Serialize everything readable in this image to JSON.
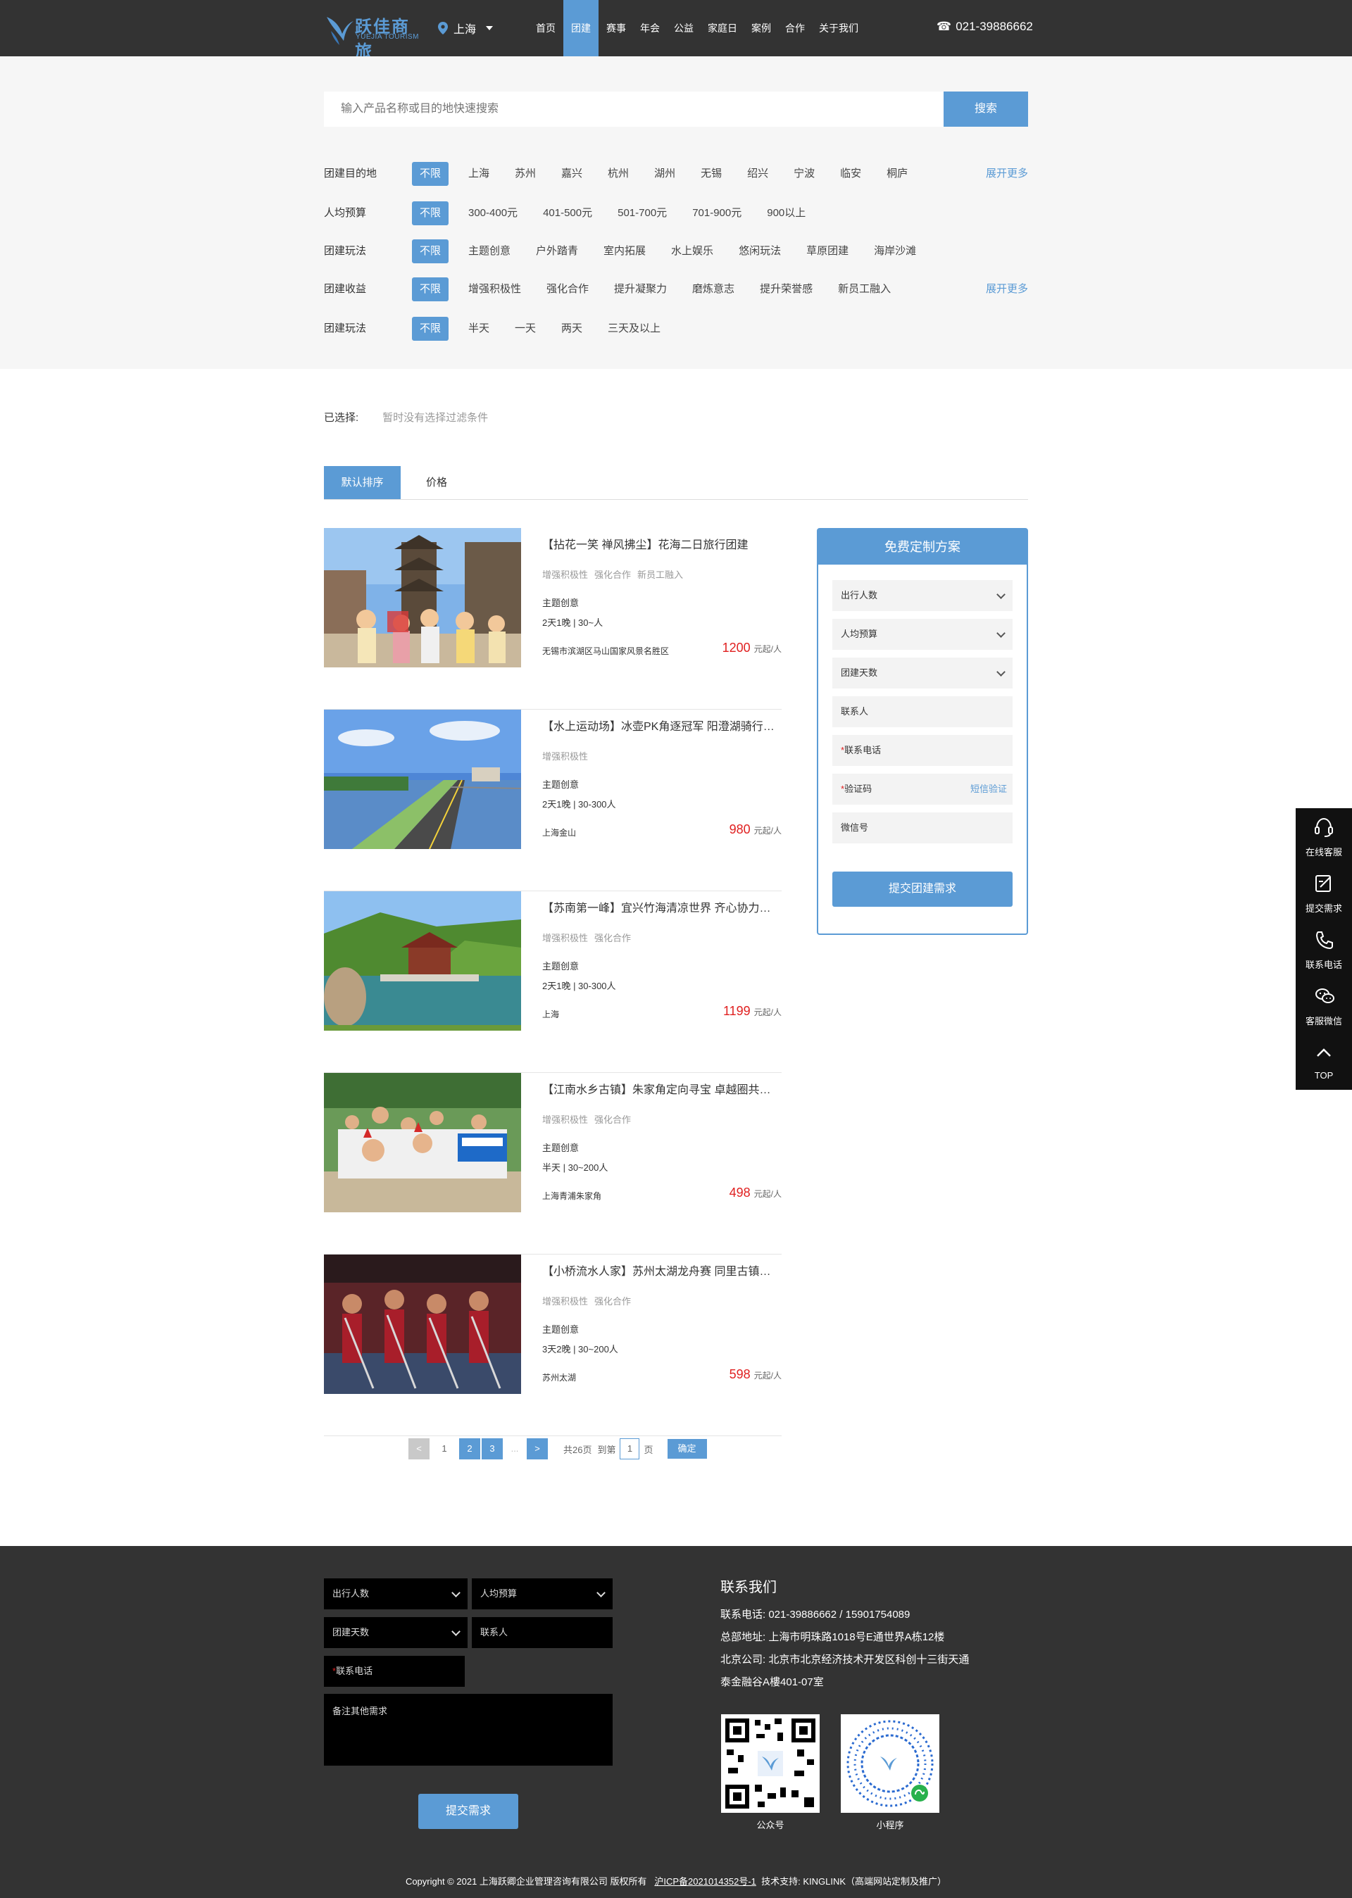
{
  "header": {
    "logo_cn": "跃佳商旅",
    "logo_en": "YUEJIA TOURISM",
    "city": "上海",
    "nav": [
      "首页",
      "团建",
      "赛事",
      "年会",
      "公益",
      "家庭日",
      "案例",
      "合作",
      "关于我们"
    ],
    "active_nav": "团建",
    "phone": "021-39886662",
    "brand_color": "#5b9bd5"
  },
  "search": {
    "placeholder": "输入产品名称或目的地快速搜索",
    "button": "搜索"
  },
  "filters": [
    {
      "label": "团建目的地",
      "selected": "不限",
      "options": [
        "上海",
        "苏州",
        "嘉兴",
        "杭州",
        "湖州",
        "无锡",
        "绍兴",
        "宁波",
        "临安",
        "桐庐"
      ],
      "more": "展开更多"
    },
    {
      "label": "人均预算",
      "selected": "不限",
      "options": [
        "300-400元",
        "401-500元",
        "501-700元",
        "701-900元",
        "900以上"
      ],
      "more": ""
    },
    {
      "label": "团建玩法",
      "selected": "不限",
      "options": [
        "主题创意",
        "户外踏青",
        "室内拓展",
        "水上娱乐",
        "悠闲玩法",
        "草原团建",
        "海岸沙滩"
      ],
      "more": ""
    },
    {
      "label": "团建收益",
      "selected": "不限",
      "options": [
        "增强积极性",
        "强化合作",
        "提升凝聚力",
        "磨炼意志",
        "提升荣誉感",
        "新员工融入"
      ],
      "more": "展开更多"
    },
    {
      "label": "团建玩法",
      "selected": "不限",
      "options": [
        "半天",
        "一天",
        "两天",
        "三天及以上"
      ],
      "more": ""
    }
  ],
  "selected_bar": {
    "label": "已选择:",
    "value": "暂时没有选择过滤条件"
  },
  "tabs": {
    "default": "默认排序",
    "price": "价格"
  },
  "products": [
    {
      "title": "【拈花一笑 禅风拂尘】花海二日旅行团建",
      "tags": [
        "增强积极性",
        "强化合作",
        "新员工融入"
      ],
      "theme": "主题创意",
      "duration": "2天1晚 | 30~人",
      "location": "无锡市滨湖区马山国家风景名胜区",
      "price": "1200",
      "unit": "元起/人"
    },
    {
      "title": "【水上运动场】冰壶PK角逐冠军 阳澄湖骑行环湖",
      "tags": [
        "增强积极性"
      ],
      "theme": "主题创意",
      "duration": "2天1晚 | 30-300人",
      "location": "上海金山",
      "price": "980",
      "unit": "元起/人"
    },
    {
      "title": "【苏南第一峰】宜兴竹海清凉世界 齐心协力共攀高峰",
      "tags": [
        "增强积极性",
        "强化合作"
      ],
      "theme": "主题创意",
      "duration": "2天1晚 | 30-300人",
      "location": "上海",
      "price": "1199",
      "unit": "元起/人"
    },
    {
      "title": "【江南水乡古镇】朱家角定向寻宝 卓越圈共创团队",
      "tags": [
        "增强积极性",
        "强化合作"
      ],
      "theme": "主题创意",
      "duration": "半天 | 30~200人",
      "location": "上海青浦朱家角",
      "price": "498",
      "unit": "元起/人"
    },
    {
      "title": "【小桥流水人家】苏州太湖龙舟赛 同里古镇休闲游",
      "tags": [
        "增强积极性",
        "强化合作"
      ],
      "theme": "主题创意",
      "duration": "3天2晚 | 30~200人",
      "location": "苏州太湖",
      "price": "598",
      "unit": "元起/人"
    }
  ],
  "side_form": {
    "title": "免费定制方案",
    "fields": [
      "出行人数",
      "人均预算",
      "团建天数",
      "联系人",
      "联系电话",
      "验证码",
      "微信号"
    ],
    "sms": "短信验证",
    "submit": "提交团建需求"
  },
  "pagination": {
    "prev": "<",
    "next": ">",
    "pages": [
      "1",
      "2",
      "3",
      "..."
    ],
    "total": "共26页",
    "goto": "到第",
    "goto_value": "1",
    "page_unit": "页",
    "ok": "确定"
  },
  "floatbar": {
    "items": [
      "在线客服",
      "提交需求",
      "联系电话",
      "客服微信",
      "TOP"
    ]
  },
  "footer": {
    "form": {
      "people": "出行人数",
      "budget": "人均预算",
      "days": "团建天数",
      "contact": "联系人",
      "phone": "联系电话",
      "remark": "备注其他需求",
      "submit": "提交需求"
    },
    "contact_title": "联系我们",
    "contact_lines": [
      "联系电话:  021-39886662 / 15901754089",
      "总部地址:  上海市明珠路1018号E通世界A栋12楼",
      "北京公司:  北京市北京经济技术开发区科创十三街天通",
      "泰金融谷A樓401-07室"
    ],
    "qr_labels": [
      "公众号",
      "小程序"
    ],
    "copyright": "Copyright © 2021 上海跃卿企业管理咨询有限公司 版权所有",
    "icp": "沪ICP备2021014352号-1",
    "tech": "技术支持: KINGLINK（高端网站定制及推广）"
  }
}
